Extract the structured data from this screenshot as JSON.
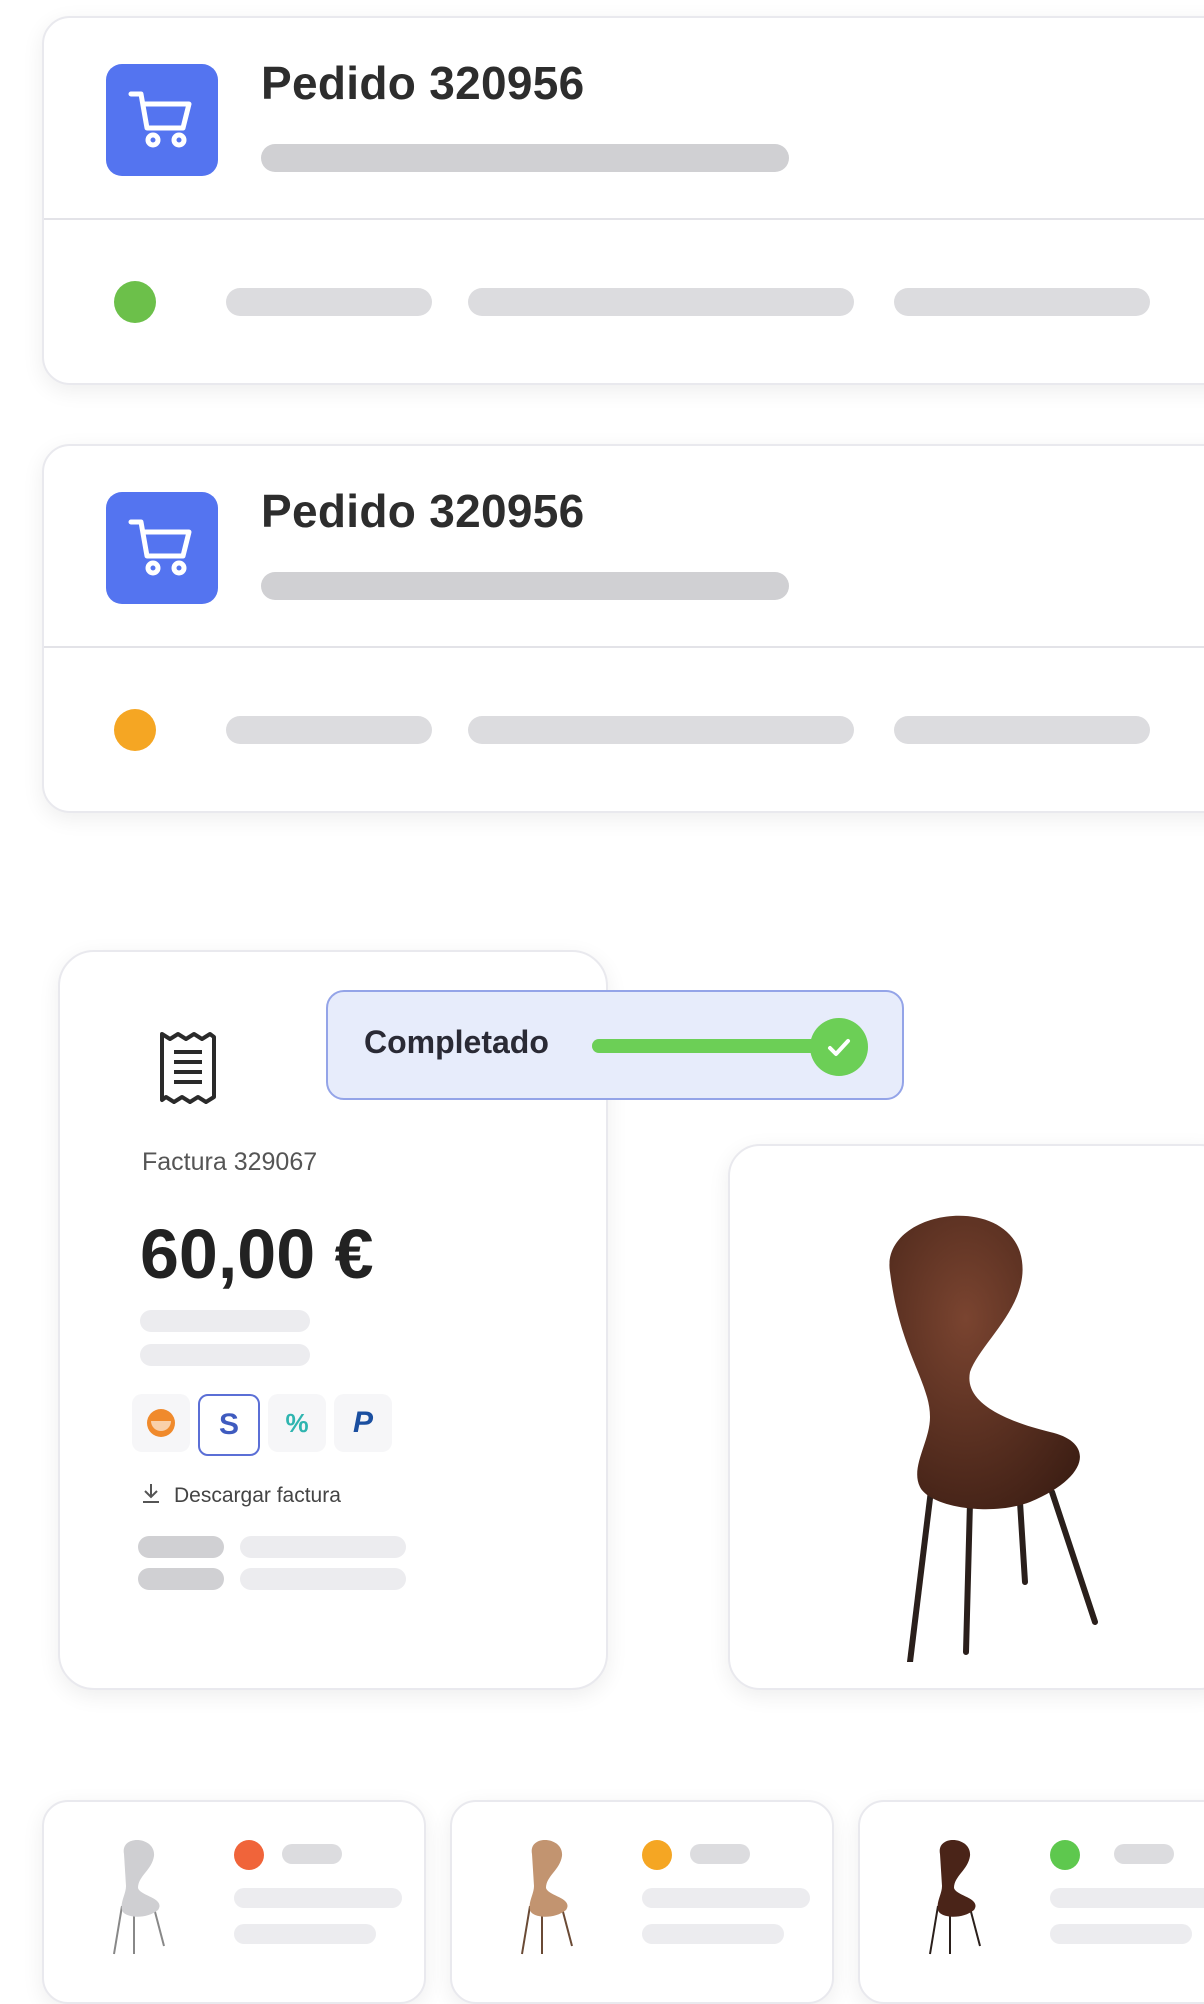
{
  "orders": [
    {
      "title": "Pedido 320956",
      "status_color": "#6cc04a"
    },
    {
      "title": "Pedido 320956",
      "status_color": "#f5a623"
    }
  ],
  "invoice": {
    "label": "Factura 329067",
    "amount": "60,00 €",
    "download_label": "Descargar factura",
    "payment_methods": [
      "klarna-icon",
      "stripe-icon",
      "sequra-icon",
      "paypal-icon"
    ],
    "payment_glyphs": [
      "",
      "S",
      "%",
      "P"
    ],
    "selected_method": "stripe-icon"
  },
  "status_badge": {
    "label": "Completado",
    "progress": 1.0,
    "color": "#6ccf56"
  },
  "product": {
    "image": "dark-wood-chair"
  },
  "variants": [
    {
      "image": "white-chair",
      "dot_color": "#f0643a"
    },
    {
      "image": "light-wood-chair",
      "dot_color": "#f5a623"
    },
    {
      "image": "dark-wood-chair",
      "dot_color": "#5ec84e"
    }
  ],
  "colors": {
    "accent": "#5474f0",
    "success": "#6ccf56"
  }
}
